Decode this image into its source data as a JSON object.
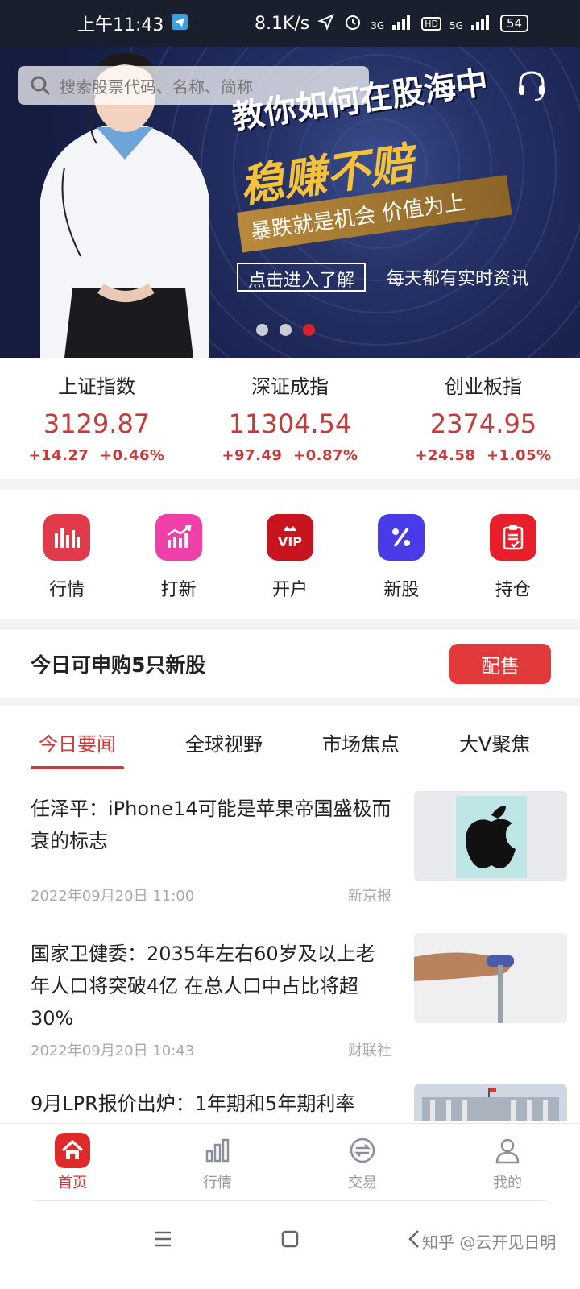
{
  "status_bar": {
    "time": "上午11:43",
    "network_speed": "8.1K/s",
    "sim1": "3G",
    "sim2": "5G",
    "hd": "HD",
    "battery": "54"
  },
  "banner": {
    "search_placeholder": "搜索股票代码、名称、简称",
    "line1": "教你如何在股海中",
    "line2": "稳赚不赔",
    "line3": "暴跌就是机会 价值为上",
    "button": "点击进入了解",
    "line4": "每天都有实时资讯",
    "slide_count": 3,
    "active_slide": 3
  },
  "indices": [
    {
      "name": "上证指数",
      "value": "3129.87",
      "change": "+14.27",
      "pct": "+0.46%"
    },
    {
      "name": "深证成指",
      "value": "11304.54",
      "change": "+97.49",
      "pct": "+0.87%"
    },
    {
      "name": "创业板指",
      "value": "2374.95",
      "change": "+24.58",
      "pct": "+1.05%"
    }
  ],
  "shortcuts": [
    {
      "label": "行情",
      "icon": "bar-chart-icon",
      "color": "#e23a4a"
    },
    {
      "label": "打新",
      "icon": "trend-up-icon",
      "color": "#f03fa8"
    },
    {
      "label": "开户",
      "icon": "vip-crown-icon",
      "color": "#c8141e"
    },
    {
      "label": "新股",
      "icon": "percent-icon",
      "color": "#4a3be8"
    },
    {
      "label": "持仓",
      "icon": "clipboard-icon",
      "color": "#e81f2a"
    }
  ],
  "ipo": {
    "text": "今日可申购5只新股",
    "button": "配售"
  },
  "news_tabs": [
    "今日要闻",
    "全球视野",
    "市场焦点",
    "大V聚焦"
  ],
  "news": [
    {
      "title": "任泽平：iPhone14可能是苹果帝国盛极而衰的标志",
      "time": "2022年09月20日 11:00",
      "source": "新京报",
      "image": "apple-logo-image"
    },
    {
      "title": "国家卫健委：2035年左右60岁及以上老年人口将突破4亿 在总人口中占比将超30%",
      "time": "2022年09月20日 10:43",
      "source": "财联社",
      "image": "elderly-hand-cane-image"
    },
    {
      "title": "9月LPR报价出炉：1年期和5年期利率",
      "time": "",
      "source": "",
      "image": "bank-building-image"
    }
  ],
  "bottom_nav": [
    {
      "label": "首页",
      "icon": "home-icon",
      "active": true
    },
    {
      "label": "行情",
      "icon": "chart-icon",
      "active": false
    },
    {
      "label": "交易",
      "icon": "exchange-icon",
      "active": false
    },
    {
      "label": "我的",
      "icon": "user-icon",
      "active": false
    }
  ],
  "watermark": "知乎 @云开见日明",
  "colors": {
    "accent": "#d33838",
    "up": "#c73a3a"
  }
}
